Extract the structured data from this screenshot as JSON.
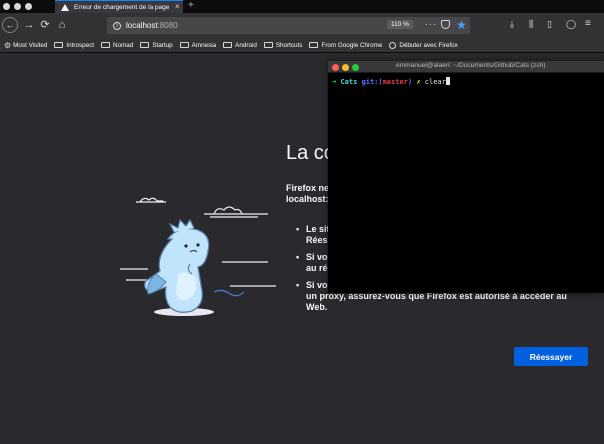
{
  "tabbar": {
    "tab_title": "Erreur de chargement de la page",
    "close_glyph": "×",
    "new_tab_glyph": "+"
  },
  "navbar": {
    "back_glyph": "←",
    "forward_glyph": "→",
    "reload_glyph": "⟳",
    "home_glyph": "⌂",
    "url_host": "localhost",
    "url_port": ":8080",
    "zoom": "110 %",
    "page_actions_glyph": "···",
    "star_glyph": "★",
    "download_glyph": "⤓",
    "library_glyph": "⫼",
    "sidebar_glyph": "▯",
    "menu_glyph": "≡"
  },
  "bookmarks": {
    "items": [
      {
        "label": "Most Visited",
        "icon": "gear-icon"
      },
      {
        "label": "Introspect",
        "icon": "folder-icon"
      },
      {
        "label": "Nomad",
        "icon": "folder-icon"
      },
      {
        "label": "Startup",
        "icon": "folder-icon"
      },
      {
        "label": "Amnesia",
        "icon": "folder-icon"
      },
      {
        "label": "Android",
        "icon": "folder-icon"
      },
      {
        "label": "Shortcuts",
        "icon": "folder-icon"
      },
      {
        "label": "From Google Chrome",
        "icon": "folder-icon"
      },
      {
        "label": "Débuter avec Firefox",
        "icon": "globe-icon"
      }
    ]
  },
  "page": {
    "title": "La co",
    "desc_line1": "Firefox ne",
    "desc_line2": "localhost:",
    "bullets": [
      {
        "line1": "Le sit",
        "line2": "Rées"
      },
      {
        "line1": "Si vo",
        "line2": "au ré"
      },
      {
        "line1": "Si vo",
        "line2": "un proxy, assurez-vous que Firefox est autorisé à accéder au",
        "line3": "Web."
      }
    ],
    "retry_label": "Réessayer"
  },
  "terminal": {
    "title": "emmanuel@alaeri: ~/Documents/Github/Cats (zsh)",
    "prompt_arrow": "➜",
    "dir": "Cats",
    "git_label": "git:(",
    "branch": "master",
    "git_close": ")",
    "x_mark": "✗",
    "command": "clear"
  },
  "colors": {
    "accent": "#0a84ff",
    "retry_button": "#0060df",
    "terminal_green": "#49d95a",
    "terminal_cyan": "#49d9d9",
    "terminal_blue": "#5078ff",
    "terminal_red": "#e04040",
    "terminal_yellow": "#e8d24a",
    "traffic_red": "#ff5f57",
    "traffic_yellow": "#febc2e",
    "traffic_green": "#28c840"
  }
}
